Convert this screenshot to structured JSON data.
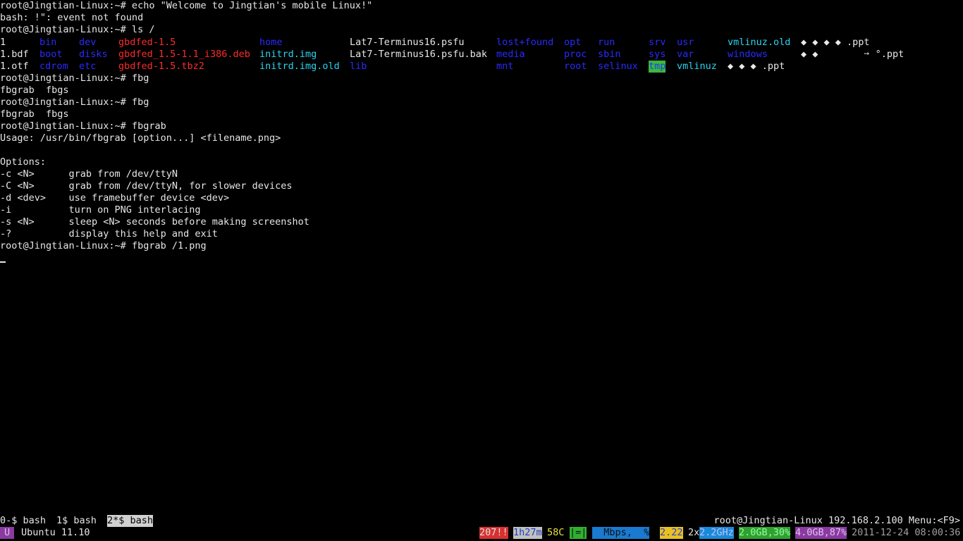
{
  "terminal": {
    "lines": [
      "root@Jingtian-Linux:~# echo \"Welcome to Jingtian's mobile Linux!\"",
      "bash: !\": event not found",
      "root@Jingtian-Linux:~# ls /",
      "",
      "",
      "",
      "root@Jingtian-Linux:~# fbg",
      "fbgrab  fbgs",
      "root@Jingtian-Linux:~# fbg",
      "fbgrab  fbgs",
      "root@Jingtian-Linux:~# fbgrab",
      "Usage: /usr/bin/fbgrab [option...] <filename.png>",
      "",
      "Options:",
      "-c <N>      grab from /dev/ttyN",
      "-C <N>      grab from /dev/ttyN, for slower devices",
      "-d <dev>    use framebuffer device <dev>",
      "-i          turn on PNG interlacing",
      "-s <N>      sleep <N> seconds before making screenshot",
      "-?          display this help and exit",
      "root@Jingtian-Linux:~# fbgrab /1.png"
    ],
    "ls_output": [
      [
        {
          "text": "1",
          "color": "white"
        },
        {
          "text": "bin",
          "color": "blue"
        },
        {
          "text": "dev",
          "color": "blue"
        },
        {
          "text": "gbdfed-1.5",
          "color": "red"
        },
        {
          "text": "home",
          "color": "blue"
        },
        {
          "text": "Lat7-Terminus16.psfu",
          "color": "white"
        },
        {
          "text": "lost+found",
          "color": "blue"
        },
        {
          "text": "opt",
          "color": "blue"
        },
        {
          "text": "run",
          "color": "blue"
        },
        {
          "text": "srv",
          "color": "blue"
        },
        {
          "text": "usr",
          "color": "blue"
        },
        {
          "text": "vmlinuz.old",
          "color": "cyan"
        },
        {
          "text": "◆ ◆ ◆ ◆ .ppt",
          "color": "white"
        }
      ],
      [
        {
          "text": "1.bdf",
          "color": "white"
        },
        {
          "text": "boot",
          "color": "blue"
        },
        {
          "text": "disks",
          "color": "blue"
        },
        {
          "text": "gbdfed_1.5-1.1_i386.deb",
          "color": "red"
        },
        {
          "text": "initrd.img",
          "color": "cyan"
        },
        {
          "text": "Lat7-Terminus16.psfu.bak",
          "color": "white"
        },
        {
          "text": "media",
          "color": "blue"
        },
        {
          "text": "proc",
          "color": "blue"
        },
        {
          "text": "sbin",
          "color": "blue"
        },
        {
          "text": "sys",
          "color": "blue"
        },
        {
          "text": "var",
          "color": "blue"
        },
        {
          "text": "windows",
          "color": "blue"
        },
        {
          "text": "◆ ◆        ➙ °.ppt",
          "color": "white"
        }
      ],
      [
        {
          "text": "1.otf",
          "color": "white"
        },
        {
          "text": "cdrom",
          "color": "blue"
        },
        {
          "text": "etc",
          "color": "blue"
        },
        {
          "text": "gbdfed-1.5.tbz2",
          "color": "red"
        },
        {
          "text": "initrd.img.old",
          "color": "cyan"
        },
        {
          "text": "lib",
          "color": "blue"
        },
        {
          "text": "mnt",
          "color": "blue"
        },
        {
          "text": "root",
          "color": "blue"
        },
        {
          "text": "selinux",
          "color": "blue"
        },
        {
          "text": "tmp",
          "color": "green-bg"
        },
        {
          "text": "vmlinuz",
          "color": "cyan"
        },
        {
          "text": "◆ ◆ ◆ .ppt",
          "color": "white"
        }
      ]
    ]
  },
  "screen": {
    "windows": [
      {
        "label": "0-$ bash"
      },
      {
        "label": "1$ bash"
      },
      {
        "label": "2*$ bash"
      }
    ],
    "host_info": "root@Jingtian-Linux 192.168.2.100 Menu:<F9>"
  },
  "byobu": {
    "logo": "U",
    "release": "Ubuntu 11.10",
    "segments": [
      {
        "text": "207!!",
        "bg": "#d83030",
        "fg": "#e0e0e0"
      },
      {
        "text": "1h27m",
        "bg": "#c0c0c0",
        "fg": "#2040c0"
      },
      {
        "text": "58C",
        "bg": "#000000",
        "fg": "#e8e040"
      },
      {
        "text": "|=|",
        "bg": "#30b030",
        "fg": "#101010"
      },
      {
        "text": "  Mbps,  %",
        "bg": "#1a7ad0",
        "fg": "#101010"
      },
      {
        "text": "2.22",
        "bg": "#e8c020",
        "fg": "#3040d0"
      },
      {
        "text": "2x",
        "bg": "#000000",
        "fg": "#e6e6e6"
      },
      {
        "text": "2.2GHz",
        "bg": "#1a8ad8",
        "fg": "#c0c0ff"
      },
      {
        "text": "2.0GB,30%",
        "bg": "#30a030",
        "fg": "#90ffa0"
      },
      {
        "text": "4.0GB,87%",
        "bg": "#8a3aa0",
        "fg": "#e0c0f0"
      },
      {
        "text": "2011-12-24 08:00:36",
        "bg": "#000000",
        "fg": "#a0a0a0"
      }
    ]
  }
}
